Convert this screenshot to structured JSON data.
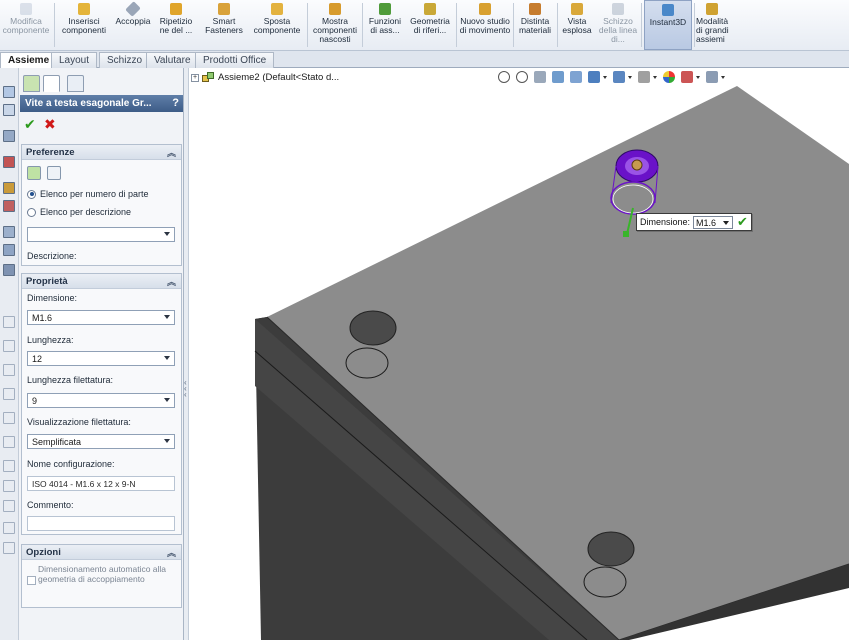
{
  "ribbon": {
    "buttons": [
      {
        "id": "modify-component",
        "label": "Modifica componente",
        "disabled": true
      },
      {
        "id": "insert-components",
        "label": "Inserisci componenti"
      },
      {
        "id": "mate",
        "label": "Accoppia"
      },
      {
        "id": "pattern",
        "label": "Ripetizio ne del ..."
      },
      {
        "id": "smart-fasteners",
        "label": "Smart Fasteners"
      },
      {
        "id": "move-component",
        "label": "Sposta componente"
      },
      {
        "id": "show-hidden",
        "label": "Mostra componenti nascosti"
      },
      {
        "id": "assembly-features",
        "label": "Funzioni di ass..."
      },
      {
        "id": "reference-geometry",
        "label": "Geometria di riferi..."
      },
      {
        "id": "new-motion-study",
        "label": "Nuovo studio di movimento"
      },
      {
        "id": "bill-of-materials",
        "label": "Distinta materiali"
      },
      {
        "id": "exploded-view",
        "label": "Vista esplosa"
      },
      {
        "id": "explode-line-sketch",
        "label": "Schizzo della linea di...",
        "disabled": true
      },
      {
        "id": "instant3d",
        "label": "Instant3D",
        "active": true
      },
      {
        "id": "large-assembly-mode",
        "label": "Modalità di grandi assiemi"
      }
    ]
  },
  "tabs": [
    "Assieme",
    "Layout",
    "Schizzo",
    "Valutare",
    "Prodotti Office"
  ],
  "active_tab": "Assieme",
  "panel": {
    "title": "Vite a testa esagonale Gr...",
    "help": "?",
    "preferences": {
      "header": "Preferenze",
      "radio_part_number": "Elenco per numero di parte",
      "radio_description": "Elenco per descrizione",
      "selected_radio": "part_number",
      "combo_value": "",
      "description_label": "Descrizione:"
    },
    "properties": {
      "header": "Proprietà",
      "size_label": "Dimensione:",
      "size_value": "M1.6",
      "length_label": "Lunghezza:",
      "length_value": "12",
      "thread_length_label": "Lunghezza filettatura:",
      "thread_length_value": "9",
      "thread_display_label": "Visualizzazione filettatura:",
      "thread_display_value": "Semplificata",
      "config_name_label": "Nome configurazione:",
      "config_name_value": "ISO 4014 - M1.6 x 12 x 9-N",
      "comment_label": "Commento:",
      "comment_value": ""
    },
    "options": {
      "header": "Opzioni",
      "auto_size": "Dimensionamento automatico alla geometria di accoppiamento",
      "auto_size_checked": false
    }
  },
  "graphics": {
    "tree_text": "Assieme2  (Default<Stato d...",
    "dim_popup_label": "Dimensione:",
    "dim_popup_value": "M1.6"
  },
  "colors": {
    "title_bar": "#4a6a95",
    "plate_top": "#8c8c8c",
    "plate_side": "#3f3f3f",
    "fastener_ring": "#6a12c8",
    "ok_green": "#2c9a1d",
    "cancel_red": "#d01818"
  },
  "icons": {
    "ok": "✔",
    "cancel": "✖",
    "collapse": "︽",
    "expand_tree": "+"
  }
}
